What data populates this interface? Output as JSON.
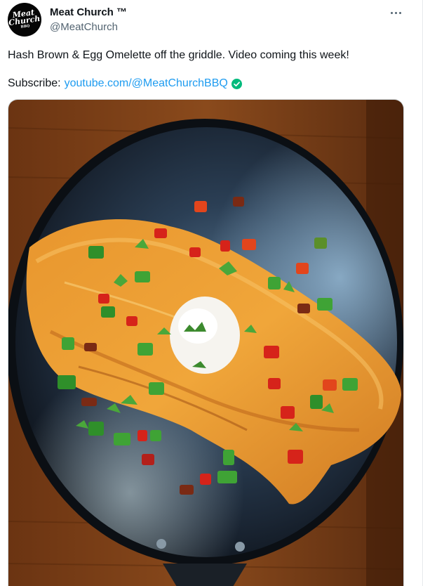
{
  "author": {
    "name": "Meat Church ™",
    "handle": "@MeatChurch",
    "avatar_text_line1": "Meat",
    "avatar_text_line2": "Church",
    "avatar_text_small": "BBQ"
  },
  "post": {
    "text": "Hash Brown & Egg Omelette off the griddle. Video coming this week!",
    "subscribe_label": "Subscribe:",
    "link_text": "youtube.com/@MeatChurchBBQ"
  },
  "icons": {
    "more": "more-horizontal-icon",
    "verified": "check-circle-icon"
  },
  "colors": {
    "link": "#1d9bf0",
    "verified": "#00ba7c",
    "text": "#0f1419",
    "muted": "#536471"
  }
}
